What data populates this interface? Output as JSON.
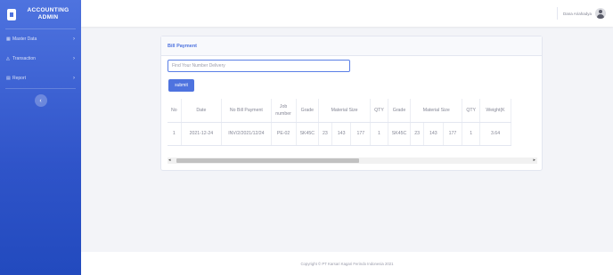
{
  "brand": {
    "title_line1": "ACCOUNTING",
    "title_line2": "ADMIN",
    "icon": "document-icon"
  },
  "sidebar": {
    "items": [
      {
        "label": "Master Data",
        "icon": "grid-icon"
      },
      {
        "label": "Transaction",
        "icon": "tag-icon"
      },
      {
        "label": "Report",
        "icon": "chart-icon"
      }
    ],
    "toggle_icon": "chevron-left-icon"
  },
  "topbar": {
    "user_name": "Dana Ariahadya"
  },
  "card": {
    "title": "Bill Payment",
    "search_placeholder": "Find Your Number Delivery",
    "submit_label": "submit"
  },
  "table": {
    "headers": [
      "No",
      "Date",
      "No Bill Payment",
      "Job number",
      "Grade",
      "Material Size",
      "QTY",
      "Grade",
      "Material Size",
      "QTY",
      "Weight(K"
    ],
    "rows": [
      {
        "no": "1",
        "date": "2021-12-24",
        "bill": "INV/2/2021/12/24",
        "job": "PE-02",
        "grade": "SK45C",
        "size": [
          "23",
          "143",
          "177"
        ],
        "qty": "1",
        "grade2": "SK45C",
        "size2": [
          "23",
          "143",
          "177"
        ],
        "qty2": "1",
        "weight": "3.64"
      }
    ]
  },
  "footer": {
    "text": "Copyright © PT Karsari Kagari Ferindo Indonesia 2021"
  },
  "colors": {
    "primary": "#4e73df",
    "sidebar_dark": "#224abe",
    "background": "#f3f4f8"
  }
}
